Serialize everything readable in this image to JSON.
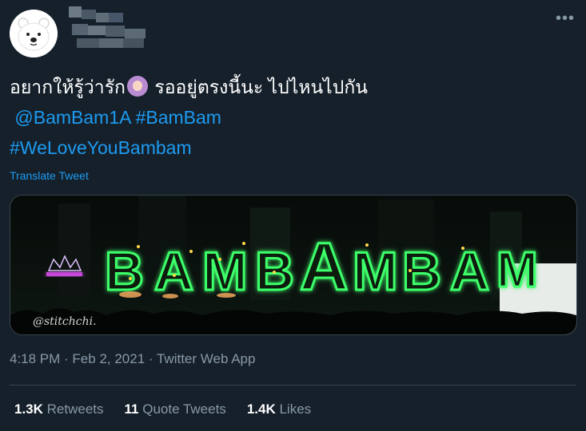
{
  "tweet": {
    "text_line1": "อยากให้รู้ว่ารัก",
    "text_line1_after_emoji": " รออยู่ตรงนี้นะ ไปไหนไปกัน",
    "mention": "@BamBam1A",
    "hashtag1": "#BamBam",
    "hashtag2": "#WeLoveYouBambam",
    "translate_label": "Translate Tweet",
    "emoji_icon": "woman-gesturing-ok-emoji"
  },
  "media": {
    "sign_text": "BAMBAMBAM",
    "watermark": "@stitchchi."
  },
  "meta": {
    "time": "4:18 PM",
    "date": "Feb 2, 2021",
    "source": "Twitter Web App",
    "separator": " · "
  },
  "stats": {
    "retweets_count": "1.3K",
    "retweets_label": " Retweets",
    "quotes_count": "11",
    "quotes_label": " Quote Tweets",
    "likes_count": "1.4K",
    "likes_label": " Likes"
  },
  "colors": {
    "background": "#15202b",
    "link": "#1d9bf0",
    "secondary_text": "#8899a6",
    "divider": "#38444d",
    "neon_green": "#3cff6a"
  }
}
